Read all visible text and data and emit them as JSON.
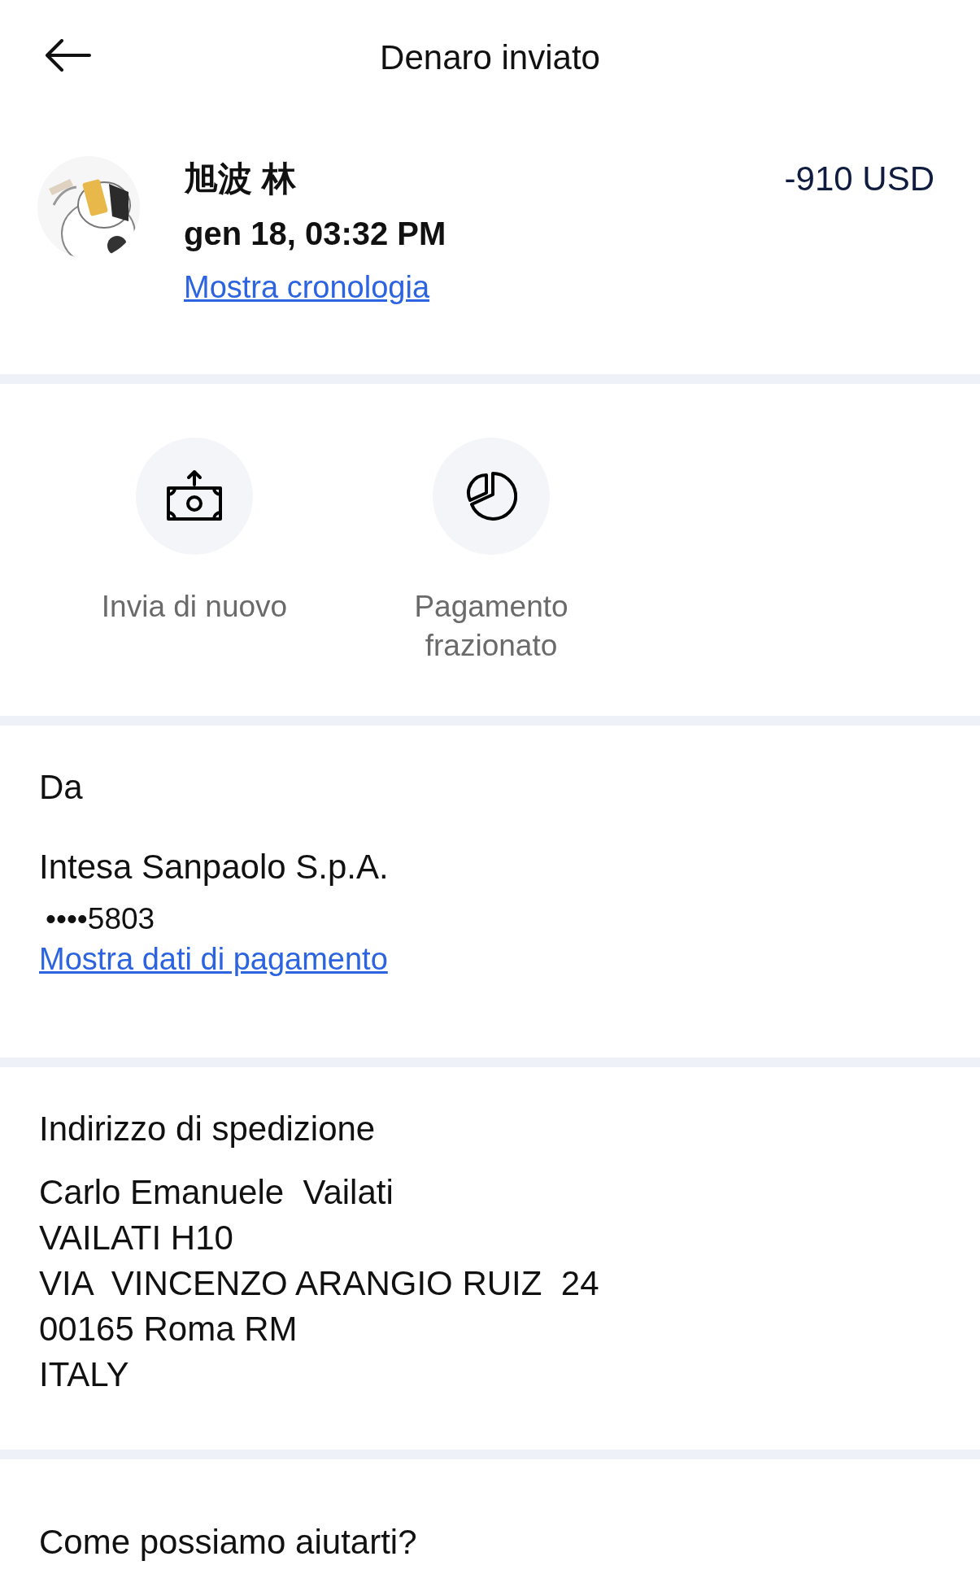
{
  "header": {
    "title": "Denaro inviato"
  },
  "transaction": {
    "name": "旭波 林",
    "date": "gen 18, 03:32 PM",
    "amount": "-910 USD",
    "history_link": "Mostra cronologia"
  },
  "actions": [
    {
      "kind": "send-again",
      "label": "Invia di nuovo"
    },
    {
      "kind": "split",
      "label": "Pagamento frazionato"
    }
  ],
  "from": {
    "heading": "Da",
    "bank": "Intesa Sanpaolo S.p.A.",
    "account": "••••5803",
    "details_link": "Mostra dati di pagamento"
  },
  "shipping": {
    "heading": "Indirizzo di spedizione",
    "lines": [
      "Carlo Emanuele  Vailati",
      "VAILATI H10",
      "VIA  VINCENZO ARANGIO RUIZ  24",
      "00165 Roma RM",
      "ITALY"
    ]
  },
  "help": {
    "heading": "Come possiamo aiutarti?"
  }
}
